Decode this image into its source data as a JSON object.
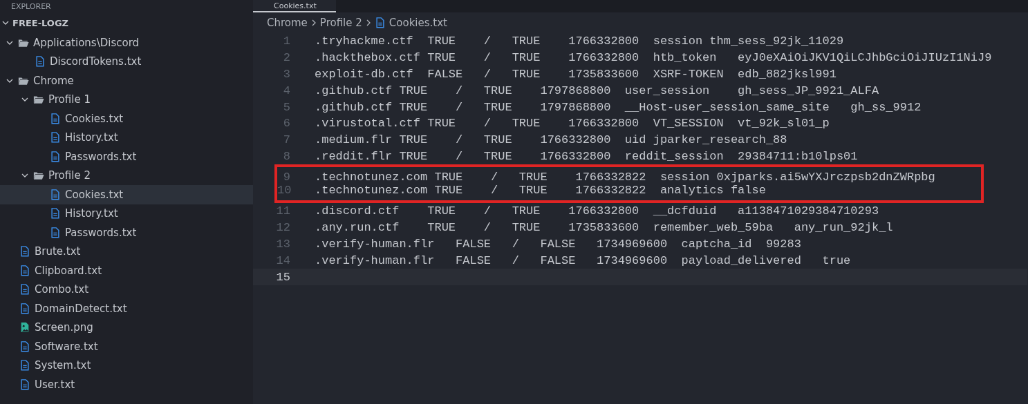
{
  "explorer": {
    "title": "EXPLORER",
    "root": {
      "label": "FREE-LOGZ",
      "expanded": true
    },
    "tree": [
      {
        "label": "Applications\\Discord",
        "kind": "folder",
        "expanded": true,
        "selected": false,
        "children": [
          {
            "label": "DiscordTokens.txt",
            "kind": "text",
            "selected": false
          }
        ]
      },
      {
        "label": "Chrome",
        "kind": "folder",
        "expanded": true,
        "selected": false,
        "children": [
          {
            "label": "Profile 1",
            "kind": "folder",
            "expanded": true,
            "selected": false,
            "children": [
              {
                "label": "Cookies.txt",
                "kind": "text",
                "selected": false
              },
              {
                "label": "History.txt",
                "kind": "text",
                "selected": false
              },
              {
                "label": "Passwords.txt",
                "kind": "text",
                "selected": false
              }
            ]
          },
          {
            "label": "Profile 2",
            "kind": "folder",
            "expanded": true,
            "selected": false,
            "children": [
              {
                "label": "Cookies.txt",
                "kind": "text",
                "selected": true
              },
              {
                "label": "History.txt",
                "kind": "text",
                "selected": false
              },
              {
                "label": "Passwords.txt",
                "kind": "text",
                "selected": false
              }
            ]
          }
        ]
      },
      {
        "label": "Brute.txt",
        "kind": "text",
        "selected": false
      },
      {
        "label": "Clipboard.txt",
        "kind": "text",
        "selected": false
      },
      {
        "label": "Combo.txt",
        "kind": "text",
        "selected": false
      },
      {
        "label": "DomainDetect.txt",
        "kind": "text",
        "selected": false
      },
      {
        "label": "Screen.png",
        "kind": "image",
        "selected": false
      },
      {
        "label": "Software.txt",
        "kind": "text",
        "selected": false
      },
      {
        "label": "System.txt",
        "kind": "text",
        "selected": false
      },
      {
        "label": "User.txt",
        "kind": "text",
        "selected": false
      }
    ]
  },
  "tab": {
    "label": "Cookies.txt",
    "selected": true
  },
  "breadcrumb": [
    "Chrome",
    "Profile 2",
    "Cookies.txt"
  ],
  "editor": {
    "lines": [
      {
        "number": "1",
        "text": ".tryhackme.ctf  TRUE    /   TRUE    1766332800  session thm_sess_92jk_11029",
        "highlighted": false,
        "current": false
      },
      {
        "number": "2",
        "text": ".hackthebox.ctf TRUE    /   TRUE    1766332800  htb_token   eyJ0eXAiOiJKV1QiLCJhbGciOiJIUzI1NiJ9",
        "highlighted": false,
        "current": false
      },
      {
        "number": "3",
        "text": "exploit-db.ctf  FALSE   /   TRUE    1735833600  XSRF-TOKEN  edb_882jksl991",
        "highlighted": false,
        "current": false
      },
      {
        "number": "4",
        "text": ".github.ctf TRUE    /   TRUE    1797868800  user_session    gh_sess_JP_9921_ALFA",
        "highlighted": false,
        "current": false
      },
      {
        "number": "5",
        "text": ".github.ctf TRUE    /   TRUE    1797868800  __Host-user_session_same_site   gh_ss_9912",
        "highlighted": false,
        "current": false
      },
      {
        "number": "6",
        "text": ".virustotal.ctf TRUE    /   TRUE    1766332800  VT_SESSION  vt_92k_sl01_p",
        "highlighted": false,
        "current": false
      },
      {
        "number": "7",
        "text": ".medium.flr TRUE    /   TRUE    1766332800  uid jparker_research_88",
        "highlighted": false,
        "current": false
      },
      {
        "number": "8",
        "text": ".reddit.flr TRUE    /   TRUE    1766332800  reddit_session  29384711:b10lps01",
        "highlighted": false,
        "current": false
      },
      {
        "number": "9",
        "text": ".technotunez.com TRUE    /   TRUE    1766332822  session 0xjparks.ai5wYXJrczpsb2dnZWRpbg",
        "highlighted": true,
        "current": false
      },
      {
        "number": "10",
        "text": ".technotunez.com TRUE    /   TRUE    1766332822  analytics false",
        "highlighted": true,
        "current": false
      },
      {
        "number": "11",
        "text": ".discord.ctf    TRUE    /   TRUE    1766332800  __dcfduid   a1138471029384710293",
        "highlighted": false,
        "current": false
      },
      {
        "number": "12",
        "text": ".any.run.ctf    TRUE    /   TRUE    1735833600  remember_web_59ba   any_run_92jk_l",
        "highlighted": false,
        "current": false
      },
      {
        "number": "13",
        "text": ".verify-human.flr   FALSE   /   FALSE   1734969600  captcha_id  99283",
        "highlighted": false,
        "current": false
      },
      {
        "number": "14",
        "text": ".verify-human.flr   FALSE   /   FALSE   1734969600  payload_delivered   true",
        "highlighted": false,
        "current": false
      },
      {
        "number": "15",
        "highlighted": false,
        "current": true
      }
    ]
  }
}
